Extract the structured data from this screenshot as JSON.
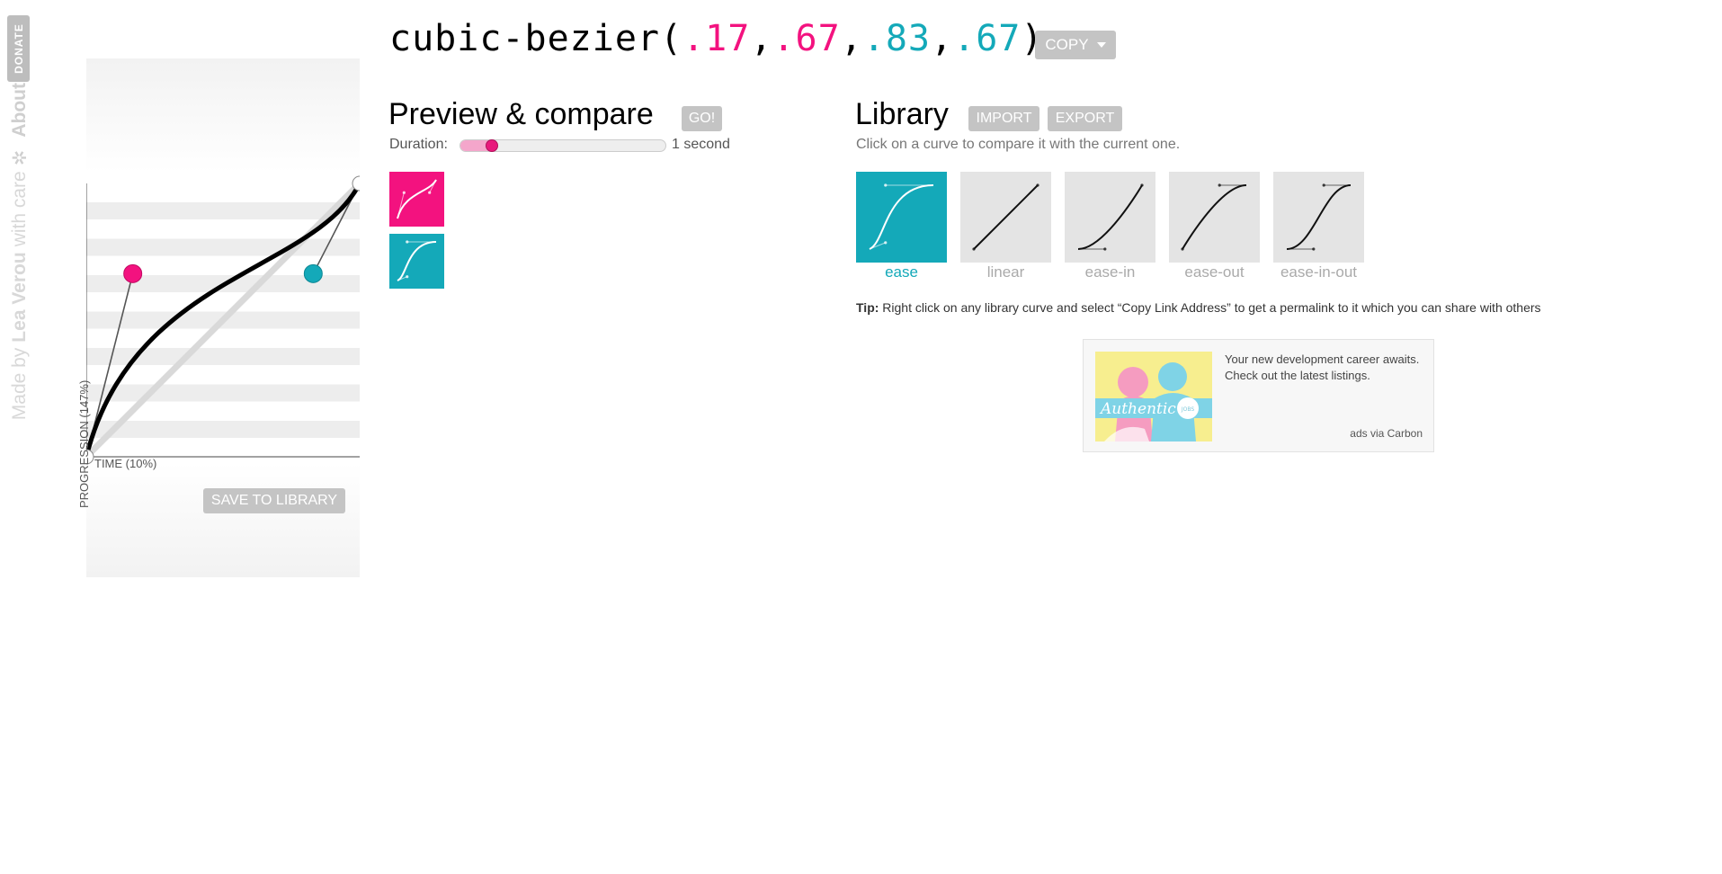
{
  "sidebar": {
    "donate": "DONATE",
    "made_by": "Made by",
    "author": "Lea Verou",
    "with_care": "with care",
    "about": "About"
  },
  "editor": {
    "ylabel": "PROGRESSION (147%)",
    "xlabel": "TIME (10%)",
    "save_button": "SAVE TO LIBRARY",
    "bezier": [
      0.17,
      0.67,
      0.83,
      0.67
    ]
  },
  "header": {
    "prefix": "cubic-bezier(",
    "v1": ".17",
    "v2": ".67",
    "v3": ".83",
    "v4": ".67",
    "sep": ",",
    "suffix": ")",
    "copy_button": "COPY"
  },
  "preview": {
    "title": "Preview & compare",
    "go_button": "GO!",
    "duration_label": "Duration:",
    "duration_value": "1 second",
    "duration_fraction": 0.1
  },
  "library": {
    "title": "Library",
    "import_button": "IMPORT",
    "export_button": "EXPORT",
    "hint": "Click on a curve to compare it with the current one.",
    "items": [
      {
        "name": "ease",
        "bezier": [
          0.25,
          0.1,
          0.25,
          1
        ],
        "active": true
      },
      {
        "name": "linear",
        "bezier": [
          0,
          0,
          1,
          1
        ],
        "active": false
      },
      {
        "name": "ease-in",
        "bezier": [
          0.42,
          0,
          1,
          1
        ],
        "active": false
      },
      {
        "name": "ease-out",
        "bezier": [
          0,
          0,
          0.58,
          1
        ],
        "active": false
      },
      {
        "name": "ease-in-out",
        "bezier": [
          0.42,
          0,
          0.58,
          1
        ],
        "active": false
      }
    ],
    "tip_label": "Tip:",
    "tip_text": "Right click on any library curve and select “Copy Link Address” to get a permalink to it which you can share with others"
  },
  "ad": {
    "text": "Your new development career awaits. Check out the latest listings.",
    "via": "ads via Carbon",
    "image_lettering": "Authentic",
    "image_badge": "JOBS"
  },
  "colors": {
    "pink": "#f3127f",
    "teal": "#14a9b9",
    "button_gray": "#c4c4c4"
  }
}
